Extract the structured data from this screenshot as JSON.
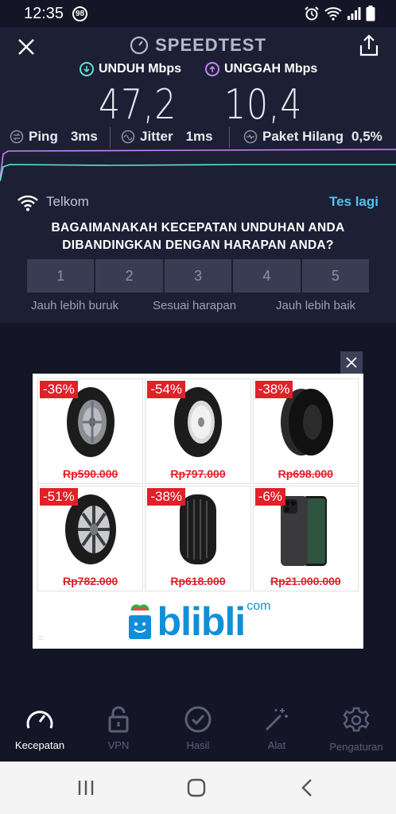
{
  "status_bar": {
    "time": "12:35",
    "badge": "98"
  },
  "header": {
    "title": "SPEEDTEST"
  },
  "download": {
    "label": "UNDUH Mbps",
    "value": "47,2",
    "color": "#5fe3d5"
  },
  "upload": {
    "label": "UNGGAH Mbps",
    "value": "10,4",
    "color": "#c685f3"
  },
  "stats": {
    "ping_label": "Ping",
    "ping_value": "3ms",
    "jitter_label": "Jitter",
    "jitter_value": "1ms",
    "loss_label": "Paket Hilang",
    "loss_value": "0,5%"
  },
  "isp": {
    "name": "Telkom",
    "retry": "Tes lagi"
  },
  "survey": {
    "question_line1": "BAGAIMANAKAH KECEPATAN UNDUHAN ANDA",
    "question_line2": "DIBANDINGKAN DENGAN HARAPAN ANDA?",
    "options": [
      "1",
      "2",
      "3",
      "4",
      "5"
    ],
    "label_left": "Jauh lebih buruk",
    "label_mid": "Sesuai harapan",
    "label_right": "Jauh lebih baik"
  },
  "ad": {
    "products": [
      {
        "discount": "-36%",
        "price": "Rp590.000",
        "icon": "tire-icon"
      },
      {
        "discount": "-54%",
        "price": "Rp797.000",
        "icon": "tire-icon"
      },
      {
        "discount": "-38%",
        "price": "Rp698.000",
        "icon": "tire-icon"
      },
      {
        "discount": "-51%",
        "price": "Rp782.000",
        "icon": "tire-icon"
      },
      {
        "discount": "-38%",
        "price": "Rp618.000",
        "icon": "tire-icon"
      },
      {
        "discount": "-6%",
        "price": "Rp21.000.000",
        "icon": "smartphone-icon"
      }
    ],
    "brand": "blibli",
    "brand_suffix": "com",
    "ad_marker": "="
  },
  "nav": {
    "items": [
      {
        "label": "Kecepatan",
        "icon": "speedometer-icon",
        "active": true
      },
      {
        "label": "VPN",
        "icon": "lock-icon",
        "active": false
      },
      {
        "label": "Hasil",
        "icon": "check-circle-icon",
        "active": false
      },
      {
        "label": "Alat",
        "icon": "magic-wand-icon",
        "active": false
      },
      {
        "label": "Pengaturan",
        "icon": "gear-icon",
        "active": false
      }
    ]
  },
  "colors": {
    "background": "#141526",
    "panel": "#1d1f34",
    "accent_link": "#4ec3f1",
    "discount_red": "#e12028",
    "brand_blue": "#0f8fd9"
  }
}
